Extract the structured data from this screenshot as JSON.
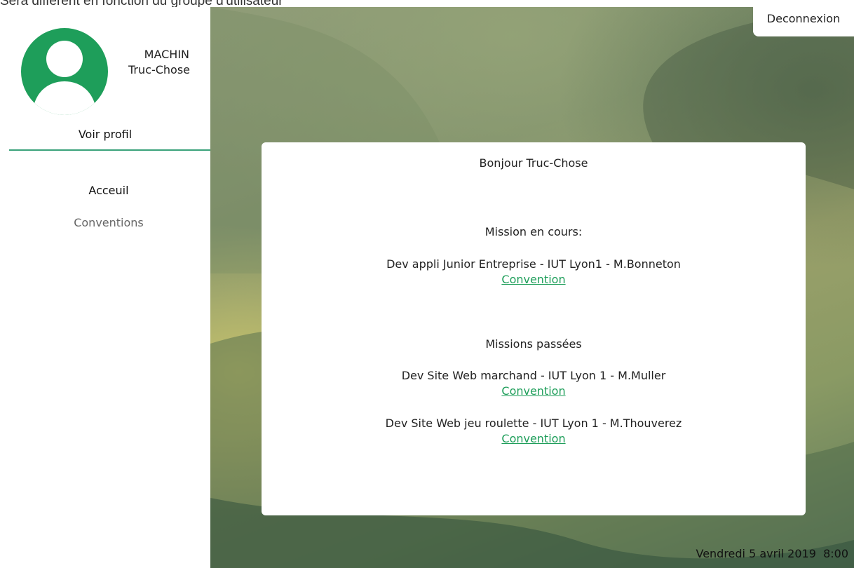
{
  "page_caption": "Sera différent en fonction du groupe d'utilisateur",
  "user": {
    "last_name": "MACHIN",
    "first_name": "Truc-Chose"
  },
  "sidebar": {
    "profile_link": "Voir profil",
    "nav": [
      {
        "label": "Acceuil"
      },
      {
        "label": "Conventions"
      }
    ]
  },
  "header": {
    "logout_label": "Deconnexion"
  },
  "card": {
    "greeting": "Bonjour Truc-Chose",
    "current_heading": "Mission en cours:",
    "current_missions": [
      {
        "title": "Dev appli Junior Entreprise - IUT Lyon1 - M.Bonneton",
        "link": "Convention"
      }
    ],
    "past_heading": "Missions passées",
    "past_missions": [
      {
        "title": "Dev Site Web marchand - IUT Lyon 1 - M.Muller",
        "link": "Convention"
      },
      {
        "title": "Dev Site Web jeu roulette - IUT Lyon 1 - M.Thouverez",
        "link": "Convention"
      }
    ]
  },
  "footer": {
    "datetime": "Vendredi 5 avril 2019  8:00"
  },
  "colors": {
    "accent": "#1e9e5a",
    "divider": "#3aa27a"
  }
}
